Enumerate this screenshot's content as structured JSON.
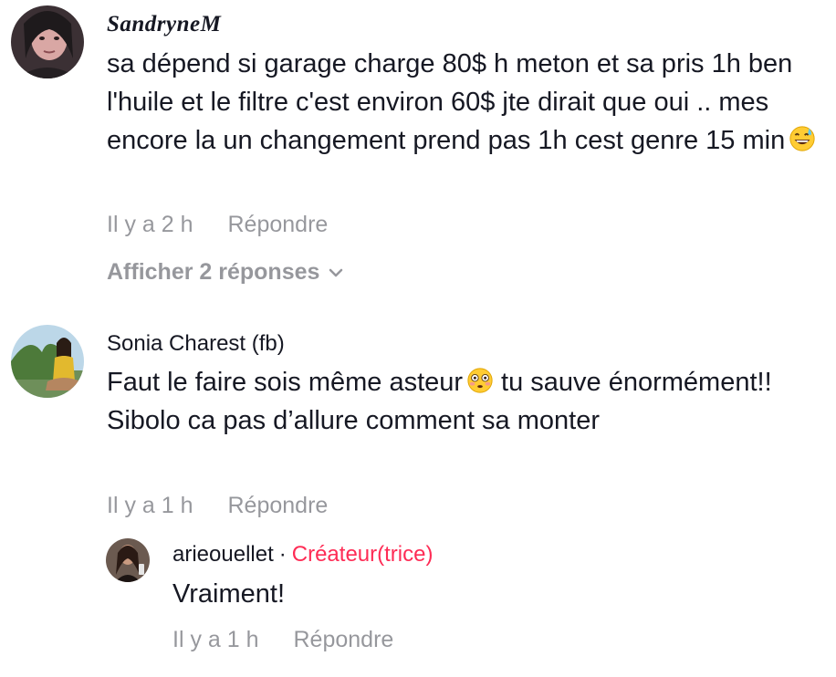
{
  "comments": [
    {
      "username": "SandryneM",
      "text": "sa dépend si garage charge 80$ h meton et sa pris 1h ben l'huile et le filtre c'est environ 60$ jte dirait que oui .. mes encore la un changement prend pas 1h cest genre 15 min",
      "emoji": "grinning-sweat-emoji",
      "time": "Il y a 2 h",
      "reply_label": "Répondre",
      "view_replies": "Afficher 2 réponses"
    },
    {
      "username": "Sonia Charest (fb)",
      "text": "Faut le faire sois même asteur",
      "emoji": "flushed-face-emoji",
      "text_after": "tu sauve énormément!! Sibolo ca pas d’allure comment sa monter",
      "time": "Il y a 1 h",
      "reply_label": "Répondre",
      "replies": [
        {
          "username": "arieouellet",
          "separator": "·",
          "creator_badge": "Créateur(trice)",
          "text": "Vraiment!",
          "time": "Il y a 1 h",
          "reply_label": "Répondre"
        }
      ]
    }
  ],
  "colors": {
    "text": "#161823",
    "muted": "rgba(22,24,35,0.45)",
    "creator": "#fe2c55"
  }
}
